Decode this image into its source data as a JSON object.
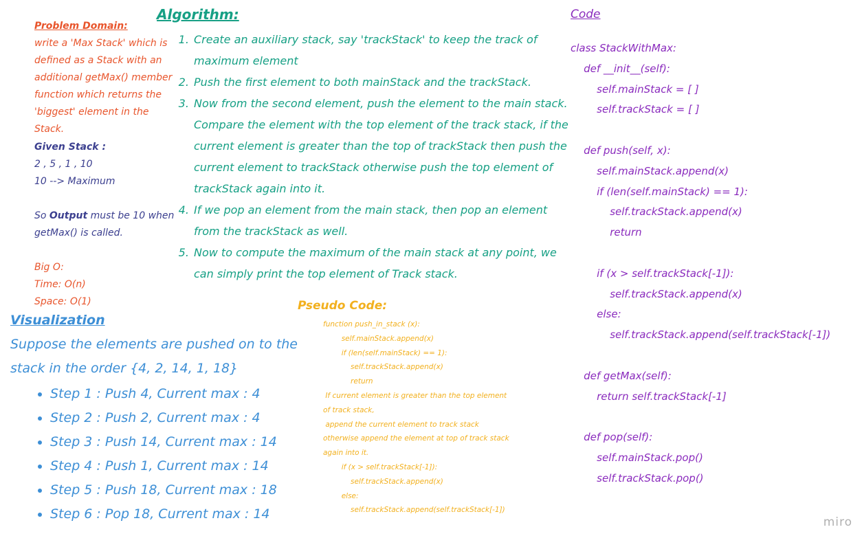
{
  "problem": {
    "heading": "Problem Domain:",
    "text": "write a 'Max Stack' which is defined as a Stack with an additional getMax() member function which returns the 'biggest' element in the Stack."
  },
  "given": {
    "heading": "Given Stack :",
    "values": "2 , 5 , 1 , 10",
    "max": "10 --> Maximum"
  },
  "output": {
    "prefix": "So ",
    "bold": "Output",
    "suffix": " must be 10 when getMax() is called."
  },
  "bigo": {
    "heading": "Big O:",
    "time": "Time: O(n)",
    "space": "Space: O(1)"
  },
  "algorithm": {
    "heading": "Algorithm:",
    "steps": [
      "Create an auxiliary stack, say 'trackStack' to keep the track of maximum element",
      "Push the first element to both mainStack and the trackStack.",
      "Now from the second element, push the element to the main stack. Compare the element with the top element of the track stack, if the current element is greater than the top of trackStack then push the current element to trackStack otherwise push the top element of trackStack again into it.",
      "If we pop an element from the main stack, then pop an element from the trackStack as well.",
      "Now to compute the maximum of the main stack at any point, we can simply print the top element of Track stack."
    ]
  },
  "visualization": {
    "heading": "Visualization",
    "description": "Suppose the elements are pushed on to the stack in the order {4, 2, 14, 1, 18}",
    "steps": [
      "Step 1 : Push 4, Current max : 4",
      "Step 2 : Push 2, Current max : 4",
      "Step 3 : Push 14, Current max : 14",
      "Step 4 : Push 1, Current max : 14",
      "Step 5 : Push 18, Current max : 18",
      "Step 6 : Pop 18, Current max : 14"
    ]
  },
  "pseudo": {
    "heading": "Pseudo Code:",
    "lines": [
      "function push_in_stack (x):",
      "        self.mainStack.append(x)",
      "        if (len(self.mainStack) == 1):",
      "            self.trackStack.append(x)",
      "            return",
      " If current element is greater than the top element",
      "of track stack,",
      " append the current element to track stack",
      "otherwise append the element at top of track stack",
      "again into it.",
      "        if (x > self.trackStack[-1]):",
      "            self.trackStack.append(x)",
      "        else:",
      "            self.trackStack.append(self.trackStack[-1])"
    ]
  },
  "code": {
    "heading": "Code",
    "lines": [
      "class StackWithMax:",
      "    def __init__(self):",
      "        self.mainStack = [ ]",
      "        self.trackStack = [ ]",
      "",
      "    def push(self, x):",
      "        self.mainStack.append(x)",
      "        if (len(self.mainStack) == 1):",
      "            self.trackStack.append(x)",
      "            return",
      "",
      "        if (x > self.trackStack[-1]):",
      "            self.trackStack.append(x)",
      "        else:",
      "            self.trackStack.append(self.trackStack[-1])",
      "",
      "    def getMax(self):",
      "        return self.trackStack[-1]",
      "",
      "    def pop(self):",
      "        self.mainStack.pop()",
      "        self.trackStack.pop()"
    ]
  },
  "brand": "miro"
}
